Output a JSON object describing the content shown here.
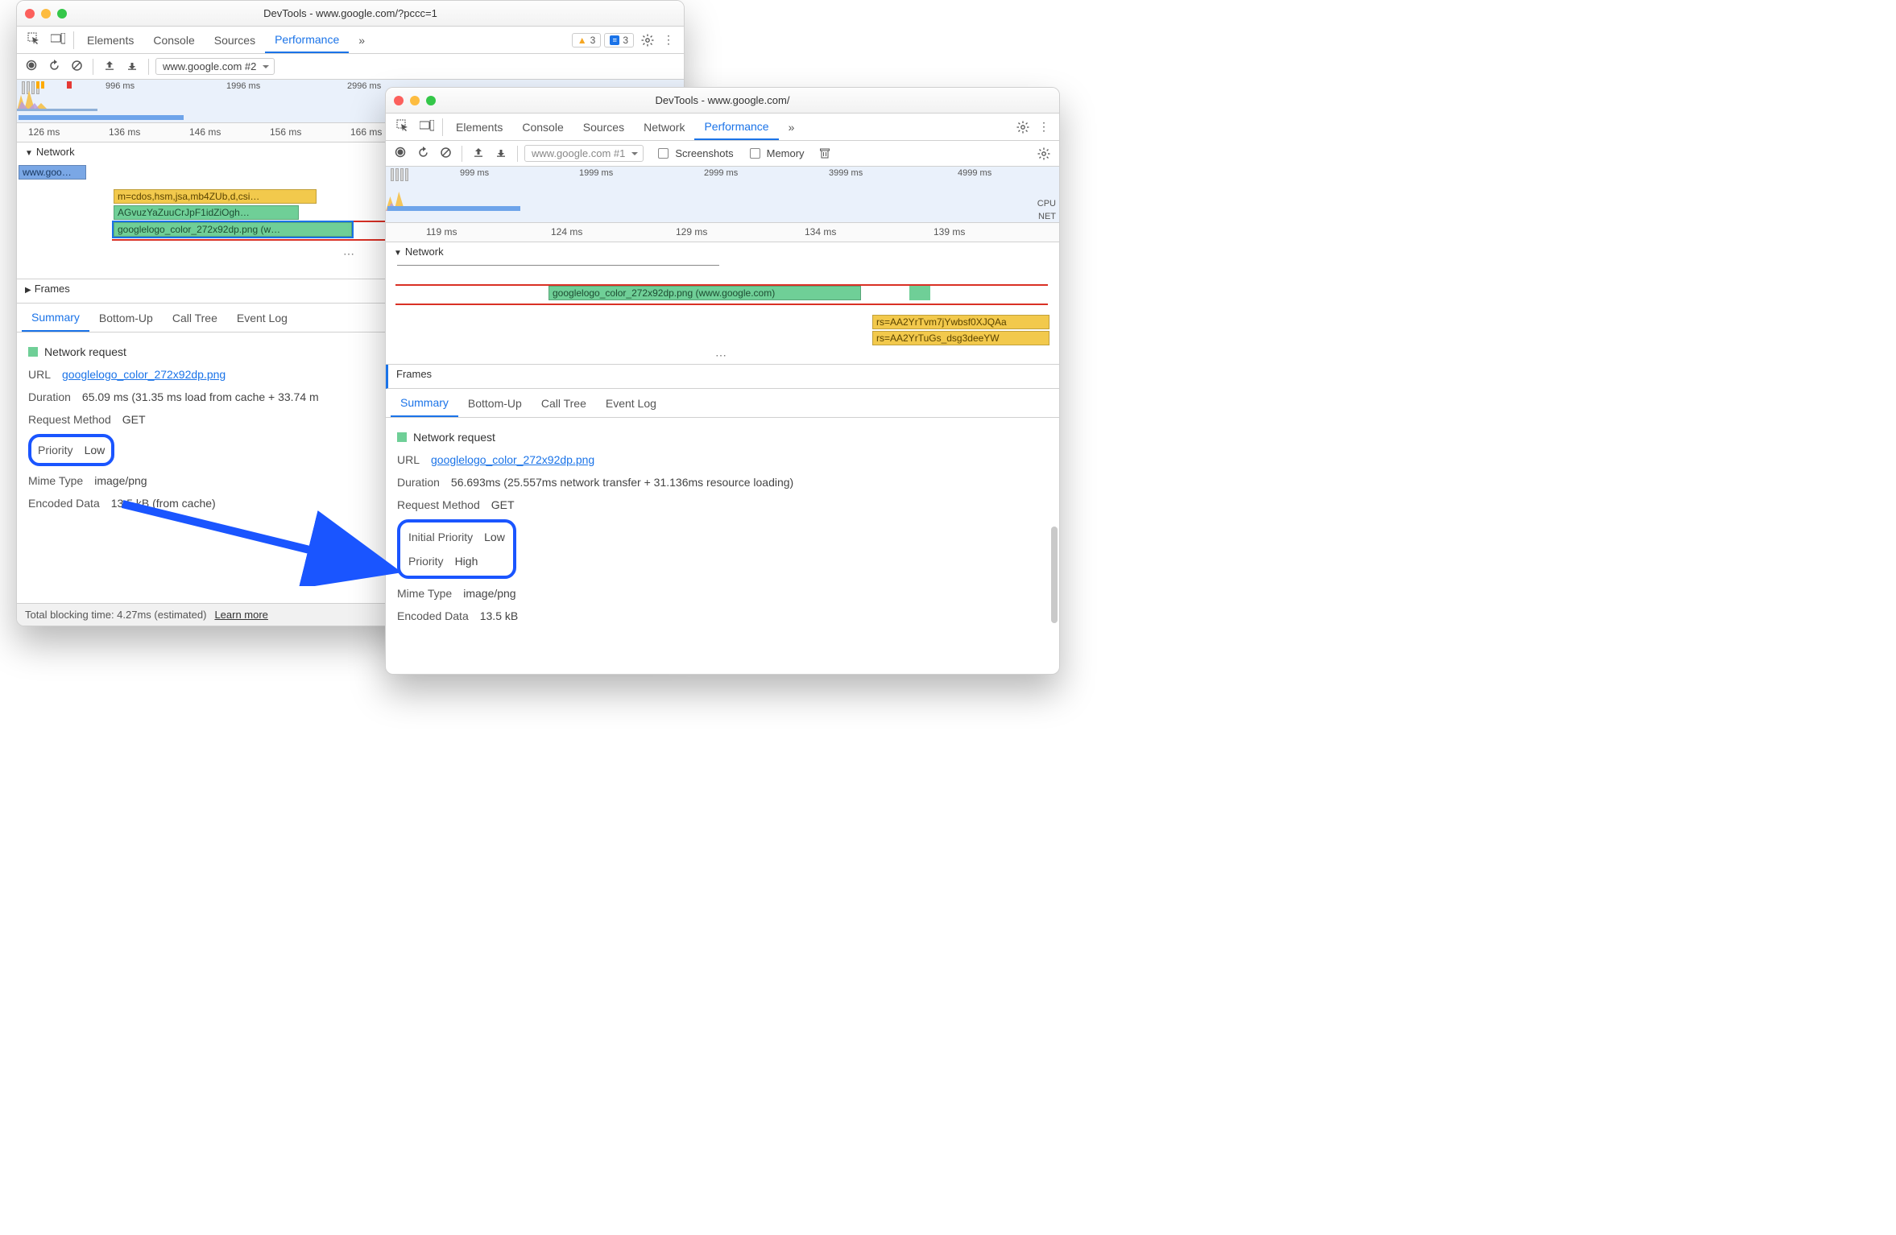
{
  "win1": {
    "title": "DevTools - www.google.com/?pccc=1",
    "tabs": [
      "Elements",
      "Console",
      "Sources",
      "Performance"
    ],
    "active_tab": "Performance",
    "more_chevron": "»",
    "badge_warn_count": "3",
    "badge_info_count": "3",
    "dropdown": "www.google.com #2",
    "overview_ticks": [
      "996 ms",
      "1996 ms",
      "2996 ms"
    ],
    "ruler_ticks": [
      "126 ms",
      "136 ms",
      "146 ms",
      "156 ms",
      "166 ms"
    ],
    "network_label": "Network",
    "bars": {
      "goo": "www.goo…",
      "yellow": "m=cdos,hsm,jsa,mb4ZUb,d,csi…",
      "green1": "AGvuzYaZuuCrJpF1idZiOgh…",
      "green2": "googlelogo_color_272x92dp.png (w…"
    },
    "frames_label": "Frames",
    "ftabs": [
      "Summary",
      "Bottom-Up",
      "Call Tree",
      "Event Log"
    ],
    "summary": {
      "title": "Network request",
      "url_label": "URL",
      "url": "googlelogo_color_272x92dp.png",
      "duration_label": "Duration",
      "duration": "65.09 ms (31.35 ms load from cache + 33.74 m",
      "method_label": "Request Method",
      "method": "GET",
      "priority_label": "Priority",
      "priority": "Low",
      "mime_label": "Mime Type",
      "mime": "image/png",
      "enc_label": "Encoded Data",
      "enc": "13.5 kB (from cache)"
    },
    "footer": {
      "text": "Total blocking time: 4.27ms (estimated)",
      "learn": "Learn more"
    }
  },
  "win2": {
    "title": "DevTools - www.google.com/",
    "tabs": [
      "Elements",
      "Console",
      "Sources",
      "Network",
      "Performance"
    ],
    "active_tab": "Performance",
    "more_chevron": "»",
    "dropdown": "www.google.com #1",
    "chk_screenshots": "Screenshots",
    "chk_memory": "Memory",
    "cpu_lbl": "CPU",
    "net_lbl": "NET",
    "overview_ticks": [
      "999 ms",
      "1999 ms",
      "2999 ms",
      "3999 ms",
      "4999 ms"
    ],
    "ruler_ticks": [
      "119 ms",
      "124 ms",
      "129 ms",
      "134 ms",
      "139 ms"
    ],
    "network_label": "Network",
    "bars": {
      "green": "googlelogo_color_272x92dp.png (www.google.com)",
      "yellow1": "rs=AA2YrTvm7jYwbsf0XJQAa",
      "yellow2": "rs=AA2YrTuGs_dsg3deeYW"
    },
    "frames_label": "Frames",
    "ftabs": [
      "Summary",
      "Bottom-Up",
      "Call Tree",
      "Event Log"
    ],
    "summary": {
      "title": "Network request",
      "url_label": "URL",
      "url": "googlelogo_color_272x92dp.png",
      "duration_label": "Duration",
      "duration": "56.693ms (25.557ms network transfer + 31.136ms resource loading)",
      "method_label": "Request Method",
      "method": "GET",
      "initprio_label": "Initial Priority",
      "initprio": "Low",
      "priority_label": "Priority",
      "priority": "High",
      "mime_label": "Mime Type",
      "mime": "image/png",
      "enc_label": "Encoded Data",
      "enc": "13.5 kB"
    }
  }
}
